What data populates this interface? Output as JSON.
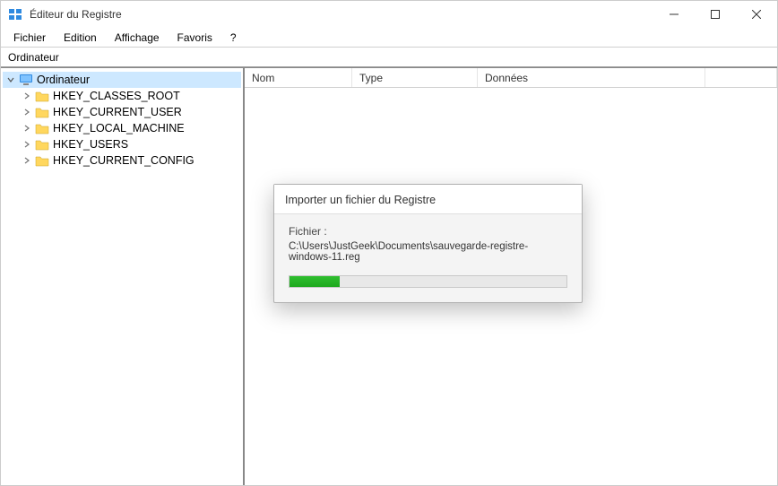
{
  "window": {
    "title": "Éditeur du Registre"
  },
  "menu": {
    "items": [
      "Fichier",
      "Edition",
      "Affichage",
      "Favoris",
      "?"
    ]
  },
  "addressbar": {
    "path": "Ordinateur"
  },
  "tree": {
    "root": {
      "label": "Ordinateur",
      "expanded": true,
      "selected": true,
      "icon": "computer-icon"
    },
    "children": [
      {
        "label": "HKEY_CLASSES_ROOT"
      },
      {
        "label": "HKEY_CURRENT_USER"
      },
      {
        "label": "HKEY_LOCAL_MACHINE"
      },
      {
        "label": "HKEY_USERS"
      },
      {
        "label": "HKEY_CURRENT_CONFIG"
      }
    ]
  },
  "columns": {
    "nom": "Nom",
    "type": "Type",
    "data": "Données"
  },
  "dialog": {
    "title": "Importer un fichier du Registre",
    "file_label": "Fichier :",
    "file_path": "C:\\Users\\JustGeek\\Documents\\sauvegarde-registre-windows-11.reg",
    "progress_percent": 18
  }
}
